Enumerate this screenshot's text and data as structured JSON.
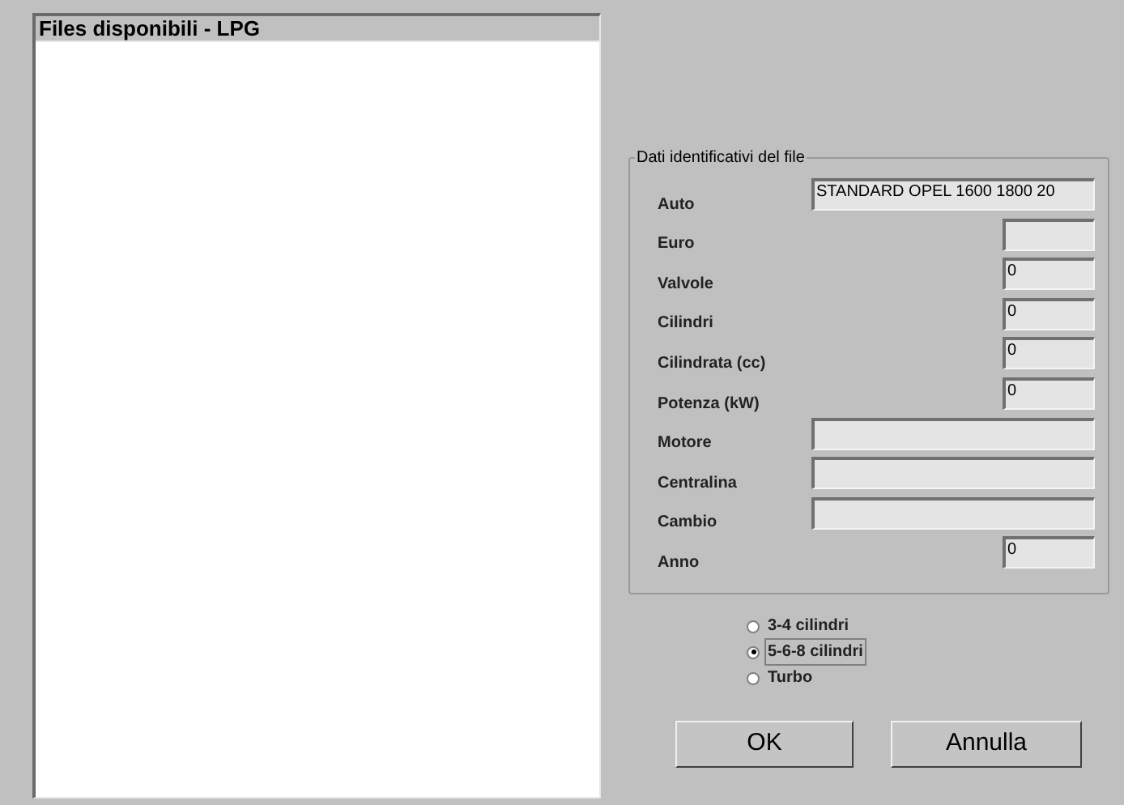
{
  "file_list": {
    "title": "Files disponibili - LPG"
  },
  "group": {
    "title": "Dati identificativi del file",
    "fields": [
      {
        "label": "Auto",
        "value": "STANDARD OPEL 1600 1800 20",
        "kind": "long"
      },
      {
        "label": "Euro",
        "kind": "short"
      },
      {
        "label": "Valvole",
        "value": "0",
        "kind": "short"
      },
      {
        "label": "Cilindri",
        "value": "0",
        "kind": "short"
      },
      {
        "label": "Cilindrata (cc)",
        "value": "0",
        "kind": "short"
      },
      {
        "label": "Potenza (kW)",
        "value": "0",
        "kind": "short"
      },
      {
        "label": "Motore",
        "kind": "long"
      },
      {
        "label": "Centralina",
        "kind": "long"
      },
      {
        "label": "Cambio",
        "kind": "long"
      },
      {
        "label": "Anno",
        "value": "0",
        "kind": "short"
      }
    ]
  },
  "cylinders": [
    {
      "label": "3-4 cilindri",
      "selected": false
    },
    {
      "label": "5-6-8 cilindri",
      "selected": true
    },
    {
      "label": "Turbo",
      "selected": false
    }
  ],
  "buttons": [
    "OK",
    "Annulla"
  ]
}
